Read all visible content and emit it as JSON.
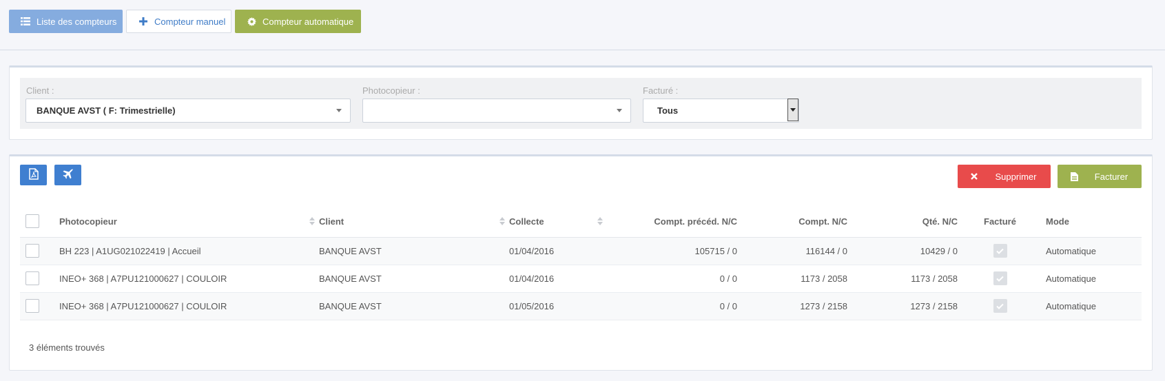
{
  "toolbar": {
    "liste_label": "Liste des compteurs",
    "manuel_label": "Compteur manuel",
    "auto_label": "Compteur automatique",
    "liste_icon": "list-icon",
    "manuel_icon": "plus-icon",
    "auto_icon": "gear-icon"
  },
  "filters": {
    "client_label": "Client :",
    "client_value": "BANQUE AVST ( F: Trimestrielle)",
    "photocopieur_label": "Photocopieur :",
    "photocopieur_value": "",
    "facture_label": "Facturé :",
    "facture_value": "Tous"
  },
  "actions": {
    "pdf_icon": "pdf-file-icon",
    "send_icon": "plane-icon",
    "supprimer_label": "Supprimer",
    "facturer_label": "Facturer"
  },
  "table": {
    "headers": {
      "photocopieur": "Photocopieur",
      "client": "Client",
      "collecte": "Collecte",
      "compt_preced": "Compt. précéd. N/C",
      "compt": "Compt. N/C",
      "qte": "Qté. N/C",
      "facture": "Facturé",
      "mode": "Mode"
    },
    "rows": [
      {
        "photocopieur": "BH 223 | A1UG021022419 | Accueil",
        "client": "BANQUE AVST",
        "collecte": "01/04/2016",
        "compt_preced": "105715 / 0",
        "compt": "116144 / 0",
        "qte": "10429 / 0",
        "facture": true,
        "mode": "Automatique"
      },
      {
        "photocopieur": "INEO+ 368 | A7PU121000627 | COULOIR",
        "client": "BANQUE AVST",
        "collecte": "01/04/2016",
        "compt_preced": "0 / 0",
        "compt": "1173 / 2058",
        "qte": "1173 / 2058",
        "facture": true,
        "mode": "Automatique"
      },
      {
        "photocopieur": "INEO+ 368 | A7PU121000627 | COULOIR",
        "client": "BANQUE AVST",
        "collecte": "01/05/2016",
        "compt_preced": "0 / 0",
        "compt": "1273 / 2158",
        "qte": "1273 / 2158",
        "facture": true,
        "mode": "Automatique"
      }
    ],
    "count_text": "3 éléments trouvés"
  },
  "colors": {
    "primary": "#3f7fd0",
    "primary_light": "#85acdf",
    "olive": "#9eb24f",
    "danger": "#e84b4b"
  }
}
